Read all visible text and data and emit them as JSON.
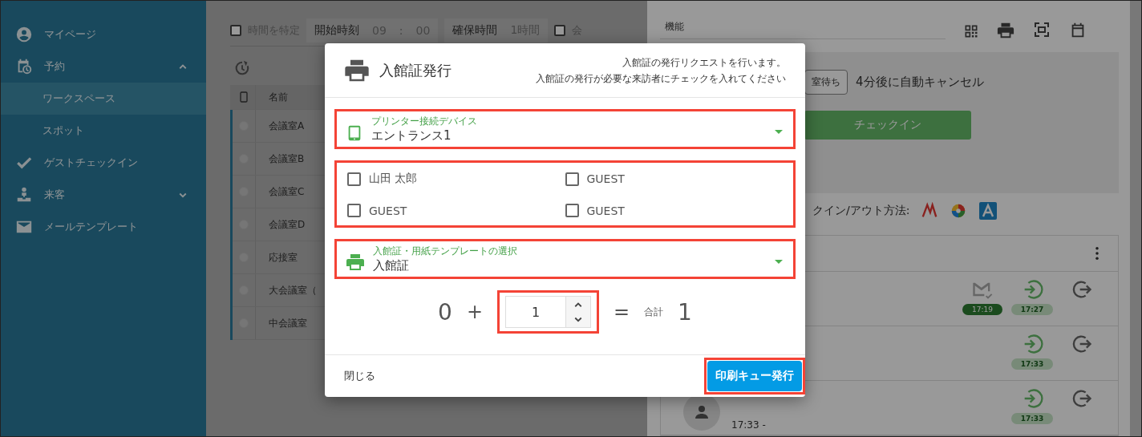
{
  "sidebar": {
    "items": [
      {
        "label": "マイページ",
        "selected": false
      },
      {
        "label": "予約",
        "expanded": true,
        "selected": false,
        "children": [
          {
            "label": "ワークスペース",
            "selected": true
          },
          {
            "label": "スポット",
            "selected": false
          }
        ]
      },
      {
        "label": "ゲストチェックイン",
        "selected": false
      },
      {
        "label": "来客",
        "expanded": false,
        "selected": false
      },
      {
        "label": "メールテンプレート",
        "selected": false
      }
    ]
  },
  "filter_bar": {
    "time_specified": {
      "label": "時間を特定",
      "checked": false
    },
    "start_time": {
      "label": "開始時刻",
      "hours": "09",
      "separator": ":",
      "minutes": "00"
    },
    "duration": {
      "label": "確保時間",
      "value": "1時間"
    },
    "option": {
      "label": "会",
      "checked": false
    }
  },
  "table": {
    "columns": [
      "名前"
    ],
    "rows": [
      {
        "name": "会議室A",
        "selected": false
      },
      {
        "name": "会議室B",
        "selected": false
      },
      {
        "name": "会議室C",
        "selected": false
      },
      {
        "name": "会議室D",
        "selected": false
      },
      {
        "name": "応接室",
        "selected": false
      },
      {
        "name": "大会議室（",
        "selected": false
      },
      {
        "name": "中会議室",
        "selected": false
      }
    ]
  },
  "right_panel": {
    "section_title": "機能",
    "status_badge": "室待ち",
    "status_note": "4分後に自動キャンセル",
    "checkin_button": "チェックイン",
    "methods_label": "クイン/アウト方法:",
    "visits": [
      {
        "sent_time": "17:19",
        "checkin_time": "17:27"
      },
      {
        "checkin_time": "17:33"
      },
      {
        "checkin_time": "17:33",
        "time_range": "17:33 -"
      }
    ]
  },
  "dialog": {
    "title": "入館証発行",
    "description": [
      "入館証の発行リクエストを行います。",
      "入館証の発行が必要な来訪者にチェックを入れてください"
    ],
    "device_field": {
      "label": "プリンター接続デバイス",
      "value": "エントランス1",
      "highlighted": true
    },
    "visitors": {
      "highlighted": true,
      "items": [
        {
          "name": "山田 太郎",
          "checked": false
        },
        {
          "name": "GUEST",
          "checked": false
        },
        {
          "name": "GUEST",
          "checked": false
        },
        {
          "name": "GUEST",
          "checked": false
        }
      ]
    },
    "template_field": {
      "label": "入館証・用紙テンプレートの選択",
      "value": "入館証",
      "highlighted": true
    },
    "count": {
      "base": "0",
      "plus": "+",
      "quantity": "1",
      "equals": "=",
      "total_label": "合計",
      "total": "1",
      "highlighted": true
    },
    "close_button": "閉じる",
    "submit_button": {
      "label": "印刷キュー発行",
      "highlighted": true
    }
  }
}
